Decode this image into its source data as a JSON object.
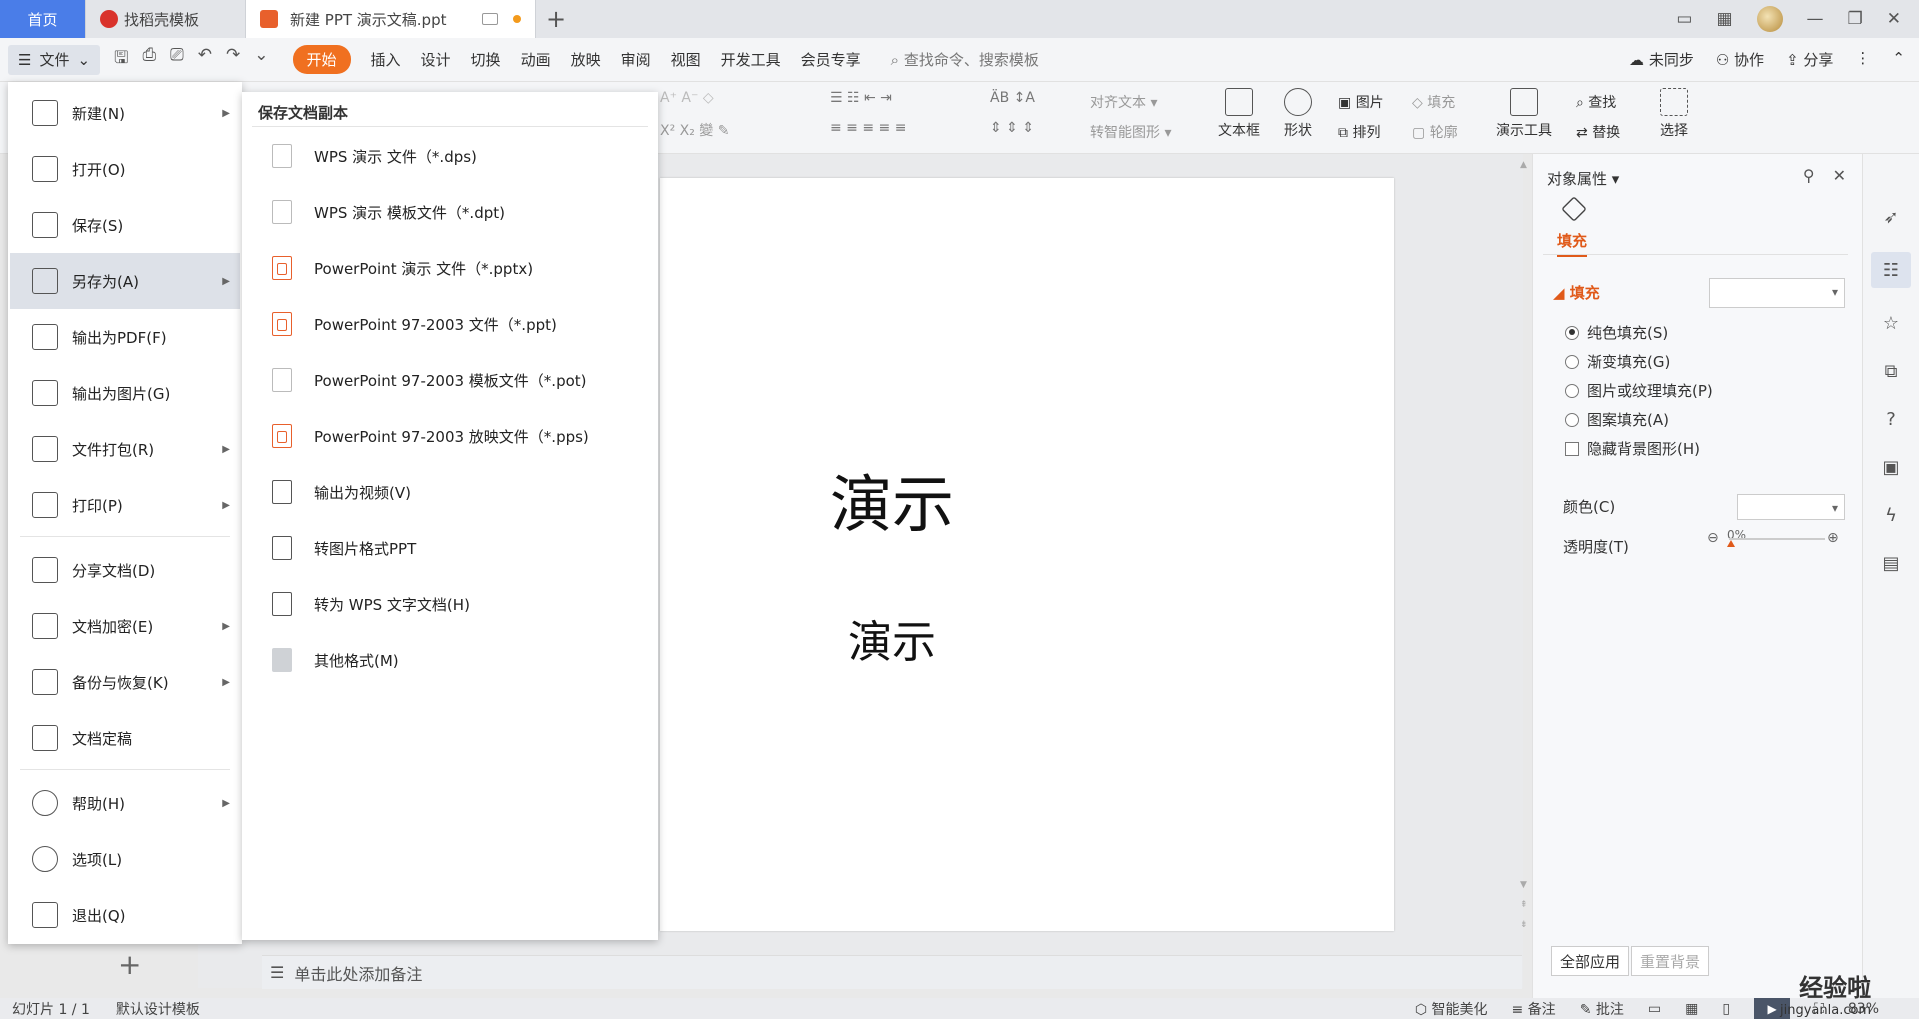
{
  "tabs": {
    "home": "首页",
    "template": "找稻壳模板",
    "document": "新建 PPT 演示文稿.ppt"
  },
  "ribbon": {
    "file_label": "文件",
    "tabs": [
      "开始",
      "插入",
      "设计",
      "切换",
      "动画",
      "放映",
      "审阅",
      "视图",
      "开发工具",
      "会员专享"
    ],
    "active_tab": "开始",
    "search_placeholder": "查找命令、搜索模板",
    "right": [
      "未同步",
      "协作",
      "分享"
    ],
    "groups": {
      "align_text": "对齐文本",
      "smart_shape": "转智能图形",
      "textbox": "文本框",
      "shape": "形状",
      "picture": "图片",
      "fill": "填充",
      "arrange": "排列",
      "outline": "轮廓",
      "present_tools": "演示工具",
      "find": "查找",
      "replace": "替换",
      "select": "选择"
    }
  },
  "file_menu": {
    "items": [
      {
        "label": "新建(N)",
        "icon": "new-file-icon",
        "arrow": true
      },
      {
        "label": "打开(O)",
        "icon": "folder-open-icon",
        "arrow": false
      },
      {
        "label": "保存(S)",
        "icon": "save-icon",
        "arrow": false
      },
      {
        "label": "另存为(A)",
        "icon": "save-as-icon",
        "arrow": true,
        "active": true
      },
      {
        "label": "输出为PDF(F)",
        "icon": "pdf-icon",
        "arrow": false
      },
      {
        "label": "输出为图片(G)",
        "icon": "image-icon",
        "arrow": false
      },
      {
        "label": "文件打包(R)",
        "icon": "package-icon",
        "arrow": true
      },
      {
        "label": "打印(P)",
        "icon": "print-icon",
        "arrow": true
      },
      {
        "label": "分享文档(D)",
        "icon": "share-icon",
        "arrow": false
      },
      {
        "label": "文档加密(E)",
        "icon": "encrypt-icon",
        "arrow": true
      },
      {
        "label": "备份与恢复(K)",
        "icon": "backup-icon",
        "arrow": true
      },
      {
        "label": "文档定稿",
        "icon": "finalize-icon",
        "arrow": false
      },
      {
        "label": "帮助(H)",
        "icon": "help-icon",
        "arrow": true
      },
      {
        "label": "选项(L)",
        "icon": "gear-icon",
        "arrow": false
      },
      {
        "label": "退出(Q)",
        "icon": "exit-icon",
        "arrow": false
      }
    ]
  },
  "save_as_menu": {
    "title": "保存文档副本",
    "items": [
      {
        "label": "WPS 演示 文件（*.dps)",
        "style": "light"
      },
      {
        "label": "WPS 演示 模板文件（*.dpt)",
        "style": "light"
      },
      {
        "label": "PowerPoint 演示 文件（*.pptx)",
        "style": "orange"
      },
      {
        "label": "PowerPoint 97-2003 文件（*.ppt)",
        "style": "orange"
      },
      {
        "label": "PowerPoint 97-2003 模板文件（*.pot)",
        "style": "light"
      },
      {
        "label": "PowerPoint 97-2003 放映文件（*.pps)",
        "style": "orange"
      },
      {
        "label": "输出为视频(V)",
        "style": "dark"
      },
      {
        "label": "转图片格式PPT",
        "style": "dark"
      },
      {
        "label": "转为 WPS 文字文档(H)",
        "style": "dark"
      },
      {
        "label": "其他格式(M)",
        "style": "gray"
      }
    ]
  },
  "slide": {
    "title": "演示",
    "subtitle": "演示"
  },
  "notes": {
    "placeholder": "单击此处添加备注"
  },
  "panel": {
    "header": "对象属性",
    "tab": "填充",
    "section": "填充",
    "options": [
      {
        "label": "纯色填充(S)",
        "type": "radio",
        "checked": true
      },
      {
        "label": "渐变填充(G)",
        "type": "radio",
        "checked": false
      },
      {
        "label": "图片或纹理填充(P)",
        "type": "radio",
        "checked": false
      },
      {
        "label": "图案填充(A)",
        "type": "radio",
        "checked": false
      },
      {
        "label": "隐藏背景图形(H)",
        "type": "checkbox",
        "checked": false
      }
    ],
    "color_label": "颜色(C)",
    "transparency_label": "透明度(T)",
    "transparency_value": "0%",
    "apply_all": "全部应用",
    "reset_bg": "重置背景"
  },
  "status": {
    "slide_info": "幻灯片 1 / 1",
    "template": "默认设计模板",
    "beautify": "智能美化",
    "notes": "备注",
    "comment": "批注",
    "zoom": "83%"
  },
  "watermark": {
    "line1": "经验啦",
    "line2": "jingyanla.com"
  },
  "colors": {
    "accent": "#f07020",
    "home_tab": "#4a7de8",
    "panel_accent": "#e05a1a"
  }
}
